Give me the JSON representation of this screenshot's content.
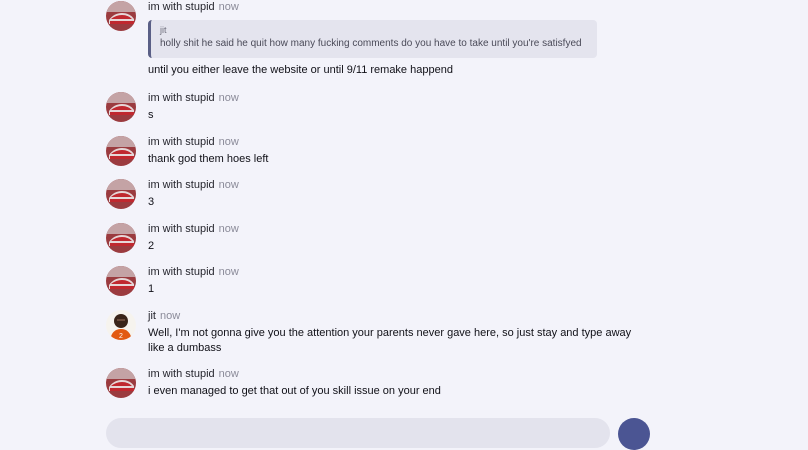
{
  "messages": [
    {
      "author": "im with stupid",
      "time": "now",
      "avatar": "red-car-avatar",
      "reply_to": {
        "author": "jit",
        "text": "holly shit he said he quit how many fucking comments do you have to take until you're satisfyed"
      },
      "text": "until you either leave the website or until 9/11 remake happend"
    },
    {
      "author": "im with stupid",
      "time": "now",
      "avatar": "red-car-avatar",
      "text": "s"
    },
    {
      "author": "im with stupid",
      "time": "now",
      "avatar": "red-car-avatar",
      "text": "thank god them hoes left"
    },
    {
      "author": "im with stupid",
      "time": "now",
      "avatar": "red-car-avatar",
      "text": "3"
    },
    {
      "author": "im with stupid",
      "time": "now",
      "avatar": "red-car-avatar",
      "text": "2"
    },
    {
      "author": "im with stupid",
      "time": "now",
      "avatar": "red-car-avatar",
      "text": "1"
    },
    {
      "author": "jit",
      "time": "now",
      "avatar": "football-player-avatar",
      "text_lines": [
        "Well, I'm not gonna give you the attention your parents never gave here, so just stay and type away",
        "like a dumbass"
      ]
    },
    {
      "author": "im with stupid",
      "time": "now",
      "avatar": "red-car-avatar",
      "text": "i even managed to get that out of you skill issue on your end"
    }
  ],
  "colors": {
    "background": "#f3f3fa",
    "quote_bar": "#5a5f86",
    "send_button": "#4b5593"
  }
}
